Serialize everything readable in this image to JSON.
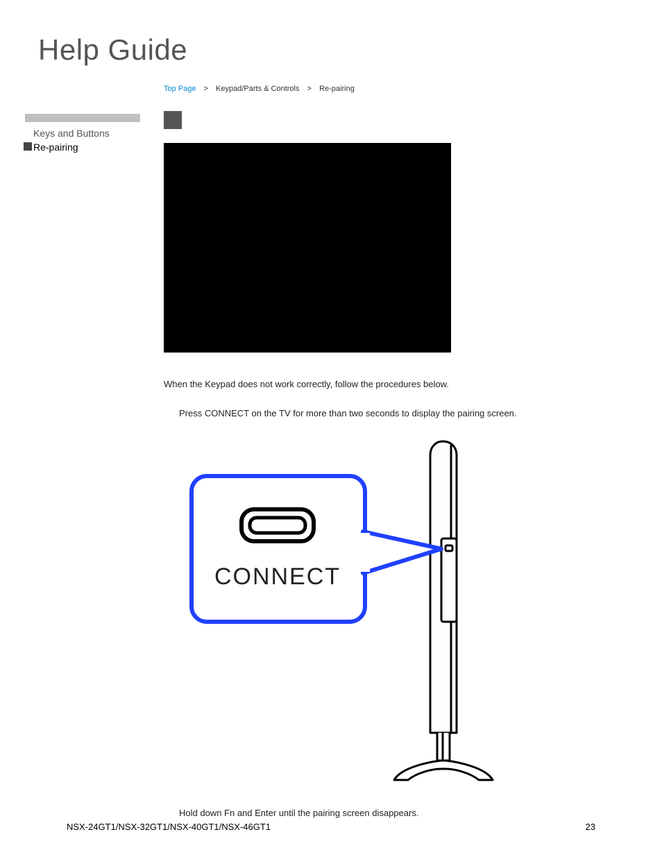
{
  "header": {
    "title": "Help Guide"
  },
  "breadcrumb": {
    "top_page": "Top Page",
    "level2": "Keypad/Parts & Controls",
    "level3": "Re-pairing"
  },
  "sidebar": {
    "items": [
      {
        "label": "Keys and Buttons",
        "active": false
      },
      {
        "label": "Re-pairing",
        "active": true
      }
    ]
  },
  "content": {
    "intro": "When the Keypad does not work correctly, follow the procedures below.",
    "step1": "Press CONNECT on the TV for more than two seconds to display the pairing screen.",
    "step2": "Hold down Fn and Enter until the pairing screen disappears.",
    "connect_label": "CONNECT"
  },
  "footer": {
    "models": "NSX-24GT1/NSX-32GT1/NSX-40GT1/NSX-46GT1",
    "page_number": "23"
  }
}
